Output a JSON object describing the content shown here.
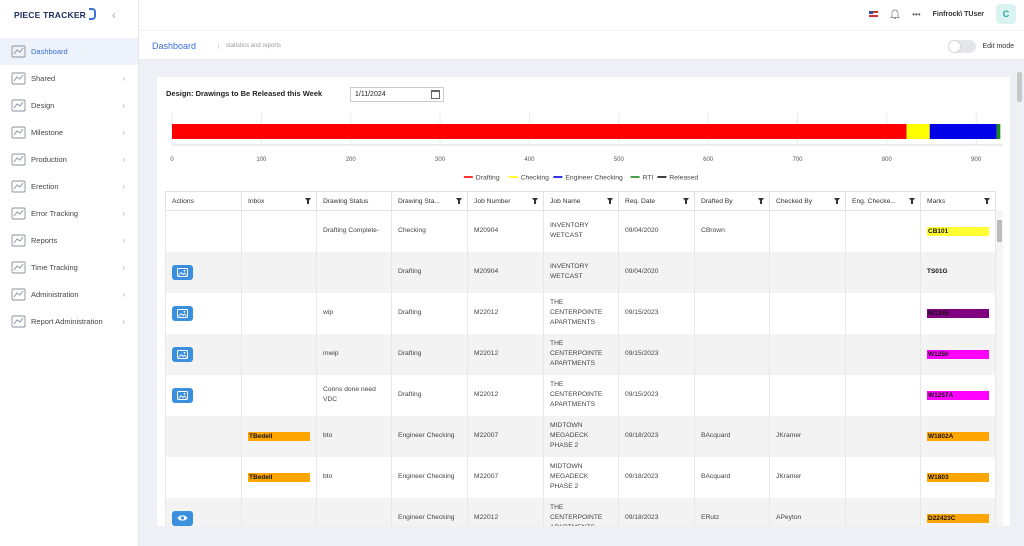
{
  "app": {
    "logo_text": "PIECE TRACKER",
    "collapse_icon": "chevron-left-icon"
  },
  "topbar": {
    "user": "Finfrock\\ TUser",
    "avatar_initial": "C",
    "more": "•••"
  },
  "sidebar": {
    "items": [
      {
        "label": "Dashboard",
        "icon": "dashboard-icon",
        "active": true
      },
      {
        "label": "Shared",
        "icon": "share-icon"
      },
      {
        "label": "Design",
        "icon": "design-icon"
      },
      {
        "label": "Milestone",
        "icon": "milestone-icon"
      },
      {
        "label": "Production",
        "icon": "production-icon"
      },
      {
        "label": "Erection",
        "icon": "crane-icon"
      },
      {
        "label": "Error Tracking",
        "icon": "error-icon"
      },
      {
        "label": "Reports",
        "icon": "reports-icon"
      },
      {
        "label": "Time Tracking",
        "icon": "calendar-icon"
      },
      {
        "label": "Administration",
        "icon": "admin-icon"
      },
      {
        "label": "Report Administration",
        "icon": "report-admin-icon"
      }
    ]
  },
  "subbar": {
    "title": "Dashboard",
    "subtitle": "statistics and reports",
    "edit_mode_label": "Edit mode"
  },
  "card": {
    "title": "Design: Drawings to Be Released this Week",
    "date_value": "1/11/2024"
  },
  "chart_data": {
    "type": "bar",
    "orientation": "horizontal-stacked",
    "xlim": [
      0,
      930
    ],
    "x_ticks": [
      "0",
      "100",
      "200",
      "300",
      "400",
      "500",
      "600",
      "700",
      "800",
      "900"
    ],
    "series": [
      {
        "name": "Drafting",
        "value": 822,
        "color": "#ff0000"
      },
      {
        "name": "Checking",
        "value": 26,
        "color": "#ffff00"
      },
      {
        "name": "Engineer Checking",
        "value": 75,
        "color": "#0000e6"
      },
      {
        "name": "RTI",
        "value": 4,
        "color": "#1a8c1a"
      },
      {
        "name": "Released",
        "value": 0,
        "color": "#111111"
      }
    ]
  },
  "table": {
    "headers": [
      "Actions",
      "Inbox",
      "Drawing Status",
      "Drawing Sta...",
      "Job Number",
      "Job Name",
      "Req. Date",
      "Drafted By",
      "Checked By",
      "Eng. Checke...",
      "Marks"
    ],
    "filterable": [
      false,
      true,
      false,
      true,
      true,
      true,
      true,
      true,
      true,
      true,
      true
    ],
    "rows": [
      {
        "action": "",
        "inbox": "",
        "inbox_color": "",
        "status": "Drafting Complete-",
        "stage": "Checking",
        "job": "M20904",
        "name": "INVENTORY WETCAST",
        "date": "09/04/2020",
        "drafted": "CBrown",
        "checked": "",
        "eng": "",
        "mark": "CB101",
        "mark_color": "#ffff33"
      },
      {
        "action": "image",
        "inbox": "",
        "inbox_color": "",
        "status": "",
        "stage": "Drafting",
        "job": "M20904",
        "name": "INVENTORY WETCAST",
        "date": "09/04/2020",
        "drafted": "",
        "checked": "",
        "eng": "",
        "mark": "TS01G",
        "mark_color": ""
      },
      {
        "action": "image",
        "inbox": "",
        "inbox_color": "",
        "status": "wip",
        "stage": "Drafting",
        "job": "M22012",
        "name": "THE CENTERPOINTE APARTMENTS",
        "date": "09/15/2023",
        "drafted": "",
        "checked": "",
        "eng": "",
        "mark": "W1245",
        "mark_color": "#800080"
      },
      {
        "action": "image",
        "inbox": "",
        "inbox_color": "",
        "status": "mwip",
        "stage": "Drafting",
        "job": "M22012",
        "name": "THE CENTERPOINTE APARTMENTS",
        "date": "09/15/2023",
        "drafted": "",
        "checked": "",
        "eng": "",
        "mark": "W1250",
        "mark_color": "#ff00ff"
      },
      {
        "action": "image",
        "inbox": "",
        "inbox_color": "",
        "status": "Conns done need VDC",
        "stage": "Drafting",
        "job": "M22012",
        "name": "THE CENTERPOINTE APARTMENTS",
        "date": "09/15/2023",
        "drafted": "",
        "checked": "",
        "eng": "",
        "mark": "W1257A",
        "mark_color": "#ff00ff"
      },
      {
        "action": "",
        "inbox": "TBedell",
        "inbox_color": "#ffa500",
        "status": "bto",
        "stage": "Engineer Checking",
        "job": "M22007",
        "name": "MIDTOWN MEGADECK PHASE 2",
        "date": "09/18/2023",
        "drafted": "BAcquard",
        "checked": "JKramer",
        "eng": "",
        "mark": "W1802A",
        "mark_color": "#ffa500"
      },
      {
        "action": "",
        "inbox": "TBedell",
        "inbox_color": "#ffa500",
        "status": "bto",
        "stage": "Engineer Checking",
        "job": "M22007",
        "name": "MIDTOWN MEGADECK PHASE 2",
        "date": "09/18/2023",
        "drafted": "BAcquard",
        "checked": "JKramer",
        "eng": "",
        "mark": "W1803",
        "mark_color": "#ffa500"
      },
      {
        "action": "view",
        "inbox": "",
        "inbox_color": "",
        "status": "",
        "stage": "Engineer Checking",
        "job": "M22012",
        "name": "THE CENTERPOINTE APARTMENTS",
        "date": "09/18/2023",
        "drafted": "ERutz",
        "checked": "APeyton",
        "eng": "",
        "mark": "D22423C",
        "mark_color": "#ffa500"
      }
    ]
  }
}
